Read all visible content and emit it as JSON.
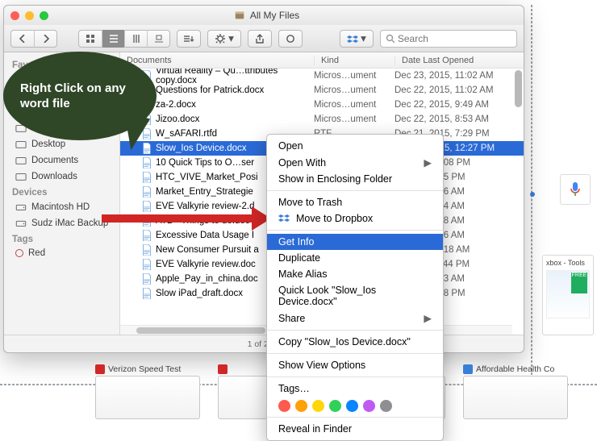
{
  "window": {
    "title": "All My Files"
  },
  "toolbar": {
    "search_placeholder": "Search"
  },
  "sidebar": {
    "favorites_header": "Favorit",
    "fav_items": [
      "",
      "",
      "",
      "",
      "Desktop",
      "Documents",
      "Downloads"
    ],
    "devices_header": "Devices",
    "dev_items": [
      "Macintosh HD",
      "Sudz iMac Backup"
    ],
    "tags_header": "Tags",
    "tag_items": [
      "Red"
    ]
  },
  "columns": {
    "c1": "Documents",
    "c2": "Kind",
    "c3": "Date Last Opened"
  },
  "files": [
    {
      "name": "Virtual Reality – Qu…ttributes copy.docx",
      "kind": "Micros…ument",
      "date": "Dec 23, 2015, 11:02 AM"
    },
    {
      "name": "Questions for Patrick.docx",
      "kind": "Micros…ument",
      "date": "Dec 22, 2015, 11:02 AM"
    },
    {
      "name": "za-2.docx",
      "kind": "Micros…ument",
      "date": "Dec 22, 2015, 9:49 AM"
    },
    {
      "name": "Jizoo.docx",
      "kind": "Micros…ument",
      "date": "Dec 22, 2015, 8:53 AM"
    },
    {
      "name": "W_sAFARI.rtfd",
      "kind": "RTF",
      "date": "Dec 21, 2015, 7:29 PM"
    },
    {
      "name": "Slow_Ios Device.docx",
      "kind": "Micros…ument",
      "date": "Dec 21, 2015, 12:27 PM",
      "sel": true
    },
    {
      "name": "10 Quick Tips to O…ser",
      "kind": "",
      "date": "1, 2015, 12:08 PM"
    },
    {
      "name": "HTC_VIVE_Market_Posi",
      "kind": "",
      "date": "1, 2015, 9:15 PM"
    },
    {
      "name": "Market_Entry_Strategie",
      "kind": "",
      "date": "1, 2015, 9:06 AM"
    },
    {
      "name": "EVE Valkyrie review-2.d",
      "kind": "",
      "date": "9, 2015, 8:04 AM"
    },
    {
      "name": "ATB - Things to do.doc",
      "kind": "",
      "date": "9, 2015, 8:38 AM"
    },
    {
      "name": "Excessive Data Usage I",
      "kind": "",
      "date": "9, 2015, 8:06 AM"
    },
    {
      "name": "New Consumer Pursuit a",
      "kind": "",
      "date": "9, 2015, 12:18 AM"
    },
    {
      "name": "EVE Valkyrie review.doc",
      "kind": "",
      "date": "8, 2015, 11:44 PM"
    },
    {
      "name": "Apple_Pay_in_china.doc",
      "kind": "",
      "date": "8, 2015, 6:43 AM"
    },
    {
      "name": "Slow iPad_draft.docx",
      "kind": "",
      "date": "7, 2015, 4:58 PM"
    }
  ],
  "status": "1 of 28,3",
  "context_menu": {
    "items": [
      {
        "label": "Open"
      },
      {
        "label": "Open With",
        "submenu": true
      },
      {
        "label": "Show in Enclosing Folder"
      },
      {
        "sep": true
      },
      {
        "label": "Move to Trash"
      },
      {
        "label": "Move to Dropbox",
        "icon": "dropbox"
      },
      {
        "sep": true
      },
      {
        "label": "Get Info",
        "highlight": true
      },
      {
        "label": "Duplicate"
      },
      {
        "label": "Make Alias"
      },
      {
        "label": "Quick Look \"Slow_Ios Device.docx\""
      },
      {
        "label": "Share",
        "submenu": true
      },
      {
        "sep": true
      },
      {
        "label": "Copy \"Slow_Ios Device.docx\""
      },
      {
        "sep": true
      },
      {
        "label": "Show View Options"
      },
      {
        "sep": true
      },
      {
        "label": "Tags…"
      },
      {
        "tags": true
      },
      {
        "sep": true
      },
      {
        "label": "Reveal in Finder"
      }
    ],
    "tag_colors": [
      "#ff5a4e",
      "#ff9f0a",
      "#ffd60a",
      "#30d158",
      "#0a84ff",
      "#bf5af2",
      "#8e8e93"
    ]
  },
  "callout": {
    "text": "Right Click on any word file"
  },
  "desktop_items": [
    {
      "label": "Verizon Speed Test",
      "fav": "#d02828"
    },
    {
      "label": "",
      "fav": "#d02828"
    },
    {
      "label": "",
      "fav": "#e7b73b"
    },
    {
      "label": "Affordable Health Co",
      "fav": "#3a7fd5"
    }
  ],
  "right_snippet": "xbox - Tools"
}
